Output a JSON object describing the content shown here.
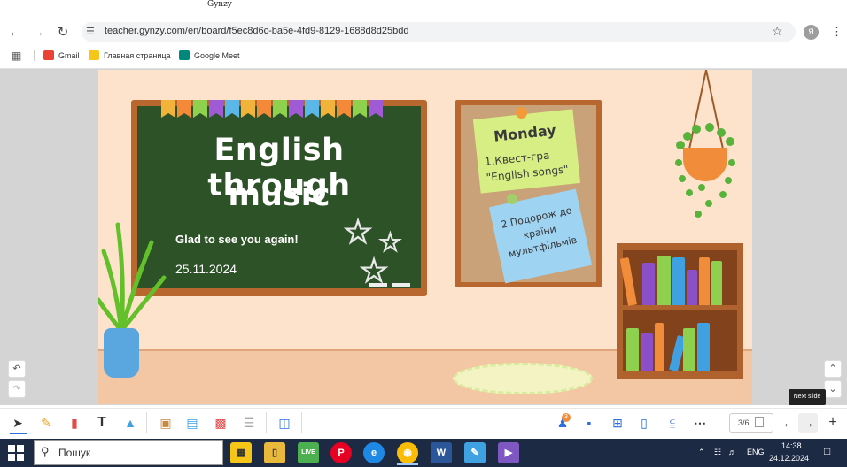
{
  "browser": {
    "tab_title": "Gynzy",
    "url": "teacher.gynzy.com/en/board/f5ec8d6c-ba5e-4fd9-8129-1688d8d25bdd",
    "profile_letter": "Я",
    "bookmarks": [
      {
        "label": "Gmail",
        "icon": "gmail-icon",
        "color": "#ea4335"
      },
      {
        "label": "Главная страница",
        "icon": "home-page-icon",
        "color": "#f5c518"
      },
      {
        "label": "Google Meet",
        "icon": "google-meet-icon",
        "color": "#00897b"
      }
    ]
  },
  "slide": {
    "title_line1": "English through",
    "title_line2": "music",
    "greeting": "Glad to see you again!",
    "date": "25.11.2024",
    "note1": {
      "title": "Monday",
      "line1": "1.Квест-гра",
      "line2": "\"English songs\""
    },
    "note2": {
      "line1": "2.Подорож до",
      "line2": "країни",
      "line3": "мультфільмів"
    }
  },
  "toolbar": {
    "notification_count": "3",
    "page_indicator": "3/6",
    "tooltip": "Next slide"
  },
  "taskbar": {
    "search_label": "Пошук",
    "language": "ENG",
    "time": "14:38",
    "date": "24.12.2024"
  }
}
